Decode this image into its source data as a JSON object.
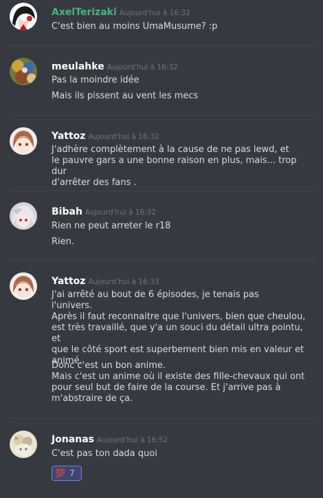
{
  "messages": [
    {
      "username": "AxelTerizaki",
      "username_color": "#43b581",
      "timestamp": "Aujourd'hui à 16:32",
      "avatar": "avatar-axelterizaki",
      "lines": [
        "C'est bien au moins UmaMusume? :p"
      ]
    },
    {
      "username": "meulahke",
      "username_color": "#ffffff",
      "timestamp": "Aujourd'hui à 16:32",
      "avatar": "avatar-meulahke",
      "lines": [
        "Pas la moindre idée",
        "Mais ils pissent au vent les mecs"
      ]
    },
    {
      "username": "Yattoz",
      "username_color": "#ffffff",
      "timestamp": "Aujourd'hui à 16:32",
      "avatar": "avatar-yattoz",
      "lines": [
        "J'adhère complètement à la cause de ne pas lewd, et\nle pauvre gars a une bonne raison en plus, mais... trop dur\nd'arrêter des fans ."
      ]
    },
    {
      "username": "Bibah",
      "username_color": "#ffffff",
      "timestamp": "Aujourd'hui à 16:32",
      "avatar": "avatar-bibah",
      "lines": [
        "Rien ne peut arreter le r18",
        "Rien."
      ]
    },
    {
      "username": "Yattoz",
      "username_color": "#ffffff",
      "timestamp": "Aujourd'hui à 16:33",
      "avatar": "avatar-yattoz",
      "lines": [
        "J'ai arrêté au bout de 6 épisodes, je tenais pas\nl'univers.\nAprès il faut reconnaitre que l'univers, bien que cheulou,\nest très travaillé, que y'a un souci du détail ultra pointu, et\nque le côté sport est superbement bien mis en valeur et\nanimé.",
        "Donc c'est un bon anime.\nMais c'est un anime où il existe des fille-chevaux qui ont\npour seul but de faire de la course. Et j'arrive pas à\nm'abstraire de ça."
      ]
    },
    {
      "username": "Jonanas",
      "username_color": "#ffffff",
      "timestamp": "Aujourd'hui à 16:52",
      "avatar": "avatar-jonanas",
      "lines": [
        "C'est pas ton dada quoi"
      ],
      "reaction": {
        "emoji": "💯",
        "count": "7"
      }
    }
  ]
}
